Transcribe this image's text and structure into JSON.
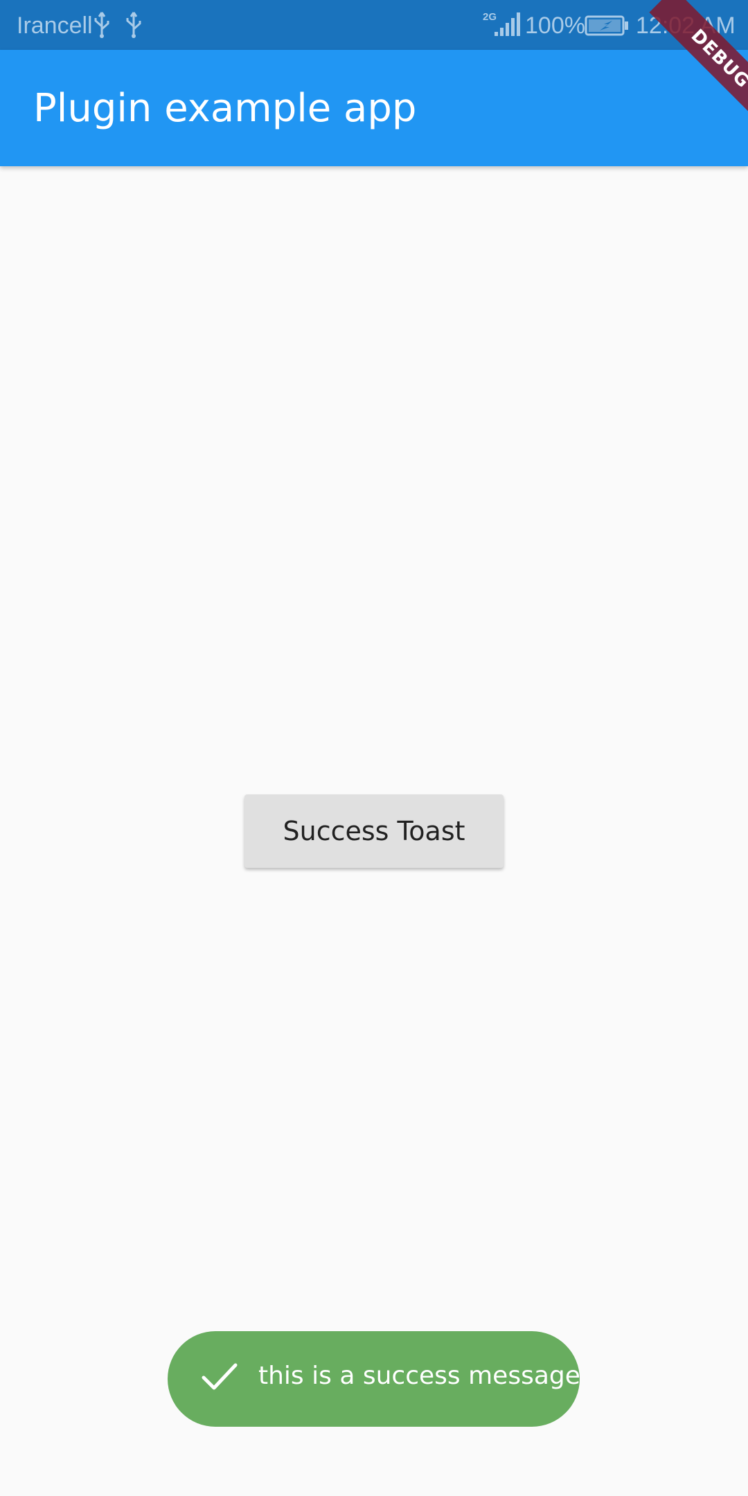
{
  "status_bar": {
    "carrier": "Irancell",
    "network_type": "2G",
    "battery": "100%",
    "time": "12:02 AM"
  },
  "app_bar": {
    "title": "Plugin example app"
  },
  "debug_banner": {
    "label": "DEBUG"
  },
  "main": {
    "button_label": "Success Toast"
  },
  "toast": {
    "message": "this is a success message",
    "icon": "check-icon"
  },
  "colors": {
    "status_bar": "#1a73bd",
    "app_bar": "#2196f3",
    "toast": "#68ad5f",
    "button": "#e0e0e0",
    "background": "#fafafa"
  }
}
